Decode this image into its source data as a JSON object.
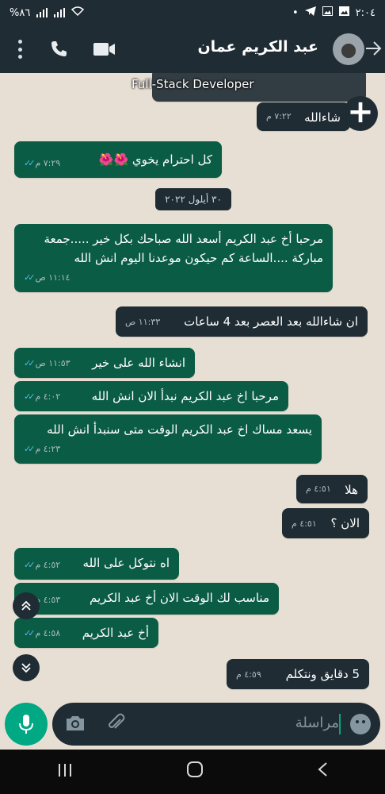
{
  "status_bar": {
    "time": "٢:٠٤",
    "battery": "%٨٦"
  },
  "header": {
    "contact_name": "عبد الكريم عمان"
  },
  "overlay": {
    "developer_banner": "Full-Stack Developer"
  },
  "messages": [
    {
      "side": "in",
      "text": "شاءالله",
      "time": "٧:٢٢ م"
    },
    {
      "side": "out",
      "text": "كل احترام يخوي 🌺🌺",
      "time": "٧:٢٩ م"
    },
    {
      "side": "out",
      "text": "مرحبا أخ عبد الكريم أسعد الله صباحك بكل خير .....جمعة مباركة ....الساعة كم حيكون موعدنا اليوم انش الله",
      "time": "١١:١٤ ص"
    },
    {
      "side": "in",
      "text": "ان شاءالله بعد العصر بعد 4 ساعات",
      "time": "١١:٣٣ ص"
    },
    {
      "side": "out",
      "text": "انشاء الله على خير",
      "time": "١١:٥٣ ص"
    },
    {
      "side": "out",
      "text": "مرحبا اخ عبد الكريم نبدأ الان انش الله",
      "time": "٤:٠٢ م"
    },
    {
      "side": "out",
      "text": "يسعد مساك اخ عبد الكريم  الوقت متى سنبدأ انش الله",
      "time": "٤:٢٣ م"
    },
    {
      "side": "in",
      "text": "هلا",
      "time": "٤:٥١ م"
    },
    {
      "side": "in",
      "text": "الان ؟",
      "time": "٤:٥١ م"
    },
    {
      "side": "out",
      "text": "اه نتوكل على الله",
      "time": "٤:٥٢ م"
    },
    {
      "side": "out",
      "text": "مناسب لك الوقت الان أخ عبد الكريم",
      "time": "٤:٥٣ م"
    },
    {
      "side": "out",
      "text": "أخ عبد الكريم",
      "time": "٤:٥٨ م"
    },
    {
      "side": "in",
      "text": "5 دقايق ونتكلم",
      "time": "٤:٥٩ م"
    }
  ],
  "date_chip": "٣٠ أيلول ٢٠٢٢",
  "composer": {
    "placeholder": "مراسلة"
  },
  "icons": {
    "menu": "more-vert-icon",
    "call": "phone-icon",
    "video": "videocam-icon",
    "back": "arrow-back-icon",
    "mic": "mic-icon",
    "attach": "paperclip-icon",
    "camera": "camera-icon",
    "emoji": "emoji-icon"
  },
  "colors": {
    "header_bg": "#1f2c34",
    "outgoing_bubble": "#0b5c45",
    "incoming_bubble": "#1f2c34",
    "accent": "#00a884",
    "read_ticks": "#53bdeb"
  }
}
